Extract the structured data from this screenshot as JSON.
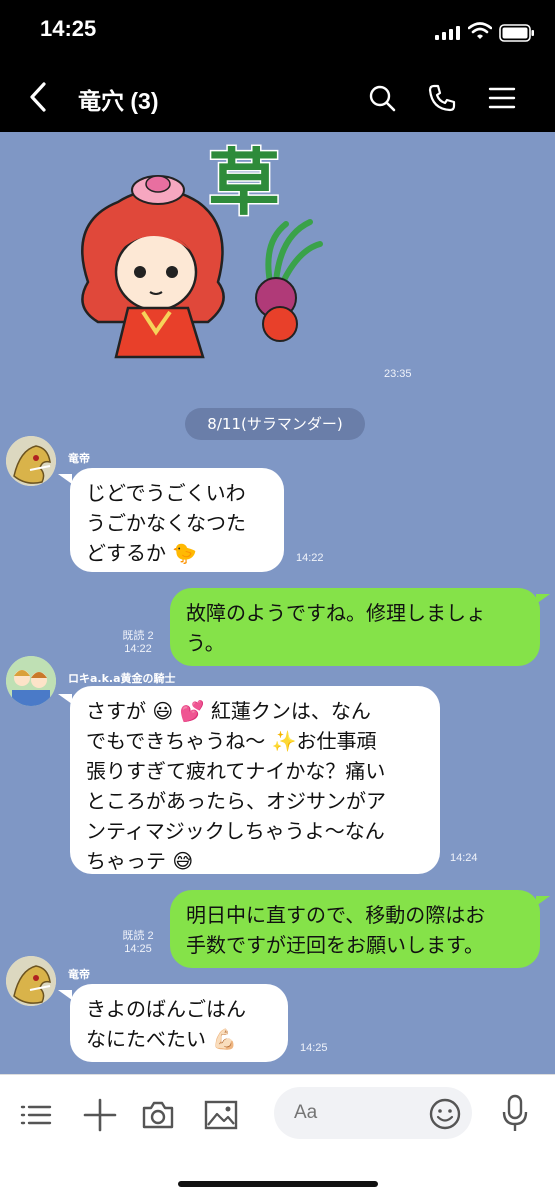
{
  "status_bar": {
    "time": "14:25"
  },
  "header": {
    "title": "竜穴 (3)"
  },
  "sticker": {
    "text": "草",
    "time": "23:35"
  },
  "date_separator": "8/11(サラマンダー)",
  "messages": [
    {
      "sender": "竜帝",
      "lines": [
        "じどでうごくいわ",
        "うごかなくなつた",
        "どするか 🐤"
      ],
      "time": "14:22"
    },
    {
      "lines": [
        "故障のようですね。修理しましょ",
        "う。"
      ],
      "read": "既読 2",
      "time": "14:22"
    },
    {
      "sender": "ロキa.k.a黄金の騎士",
      "lines": [
        "さすが 😃 💕 紅蓮クンは、なん",
        "でもできちゃうね〜 ✨お仕事頑",
        "張りすぎて疲れてナイかな？痛い",
        "ところがあったら、オジサンがア",
        "ンティマジックしちゃうよ〜なん",
        "ちゃっテ 😅"
      ],
      "time": "14:24"
    },
    {
      "lines": [
        "明日中に直すので、移動の際はお",
        "手数ですが迂回をお願いします。"
      ],
      "read": "既読 2",
      "time": "14:25"
    },
    {
      "sender": "竜帝",
      "lines": [
        "きよのばんごはん",
        "なにたべたい 💪🏻"
      ],
      "time": "14:25"
    }
  ],
  "input": {
    "placeholder": "Aa"
  },
  "icons": {
    "back": "chevron-left-icon",
    "search": "search-icon",
    "call": "phone-icon",
    "menu": "hamburger-icon",
    "list": "list-icon",
    "plus": "plus-icon",
    "camera": "camera-icon",
    "image": "image-icon",
    "emoji": "emoji-icon",
    "mic": "mic-icon"
  },
  "colors": {
    "chat_bg": "#7f97c5",
    "outgoing_bubble": "#85e249",
    "incoming_bubble": "#ffffff",
    "header": "#000000"
  }
}
